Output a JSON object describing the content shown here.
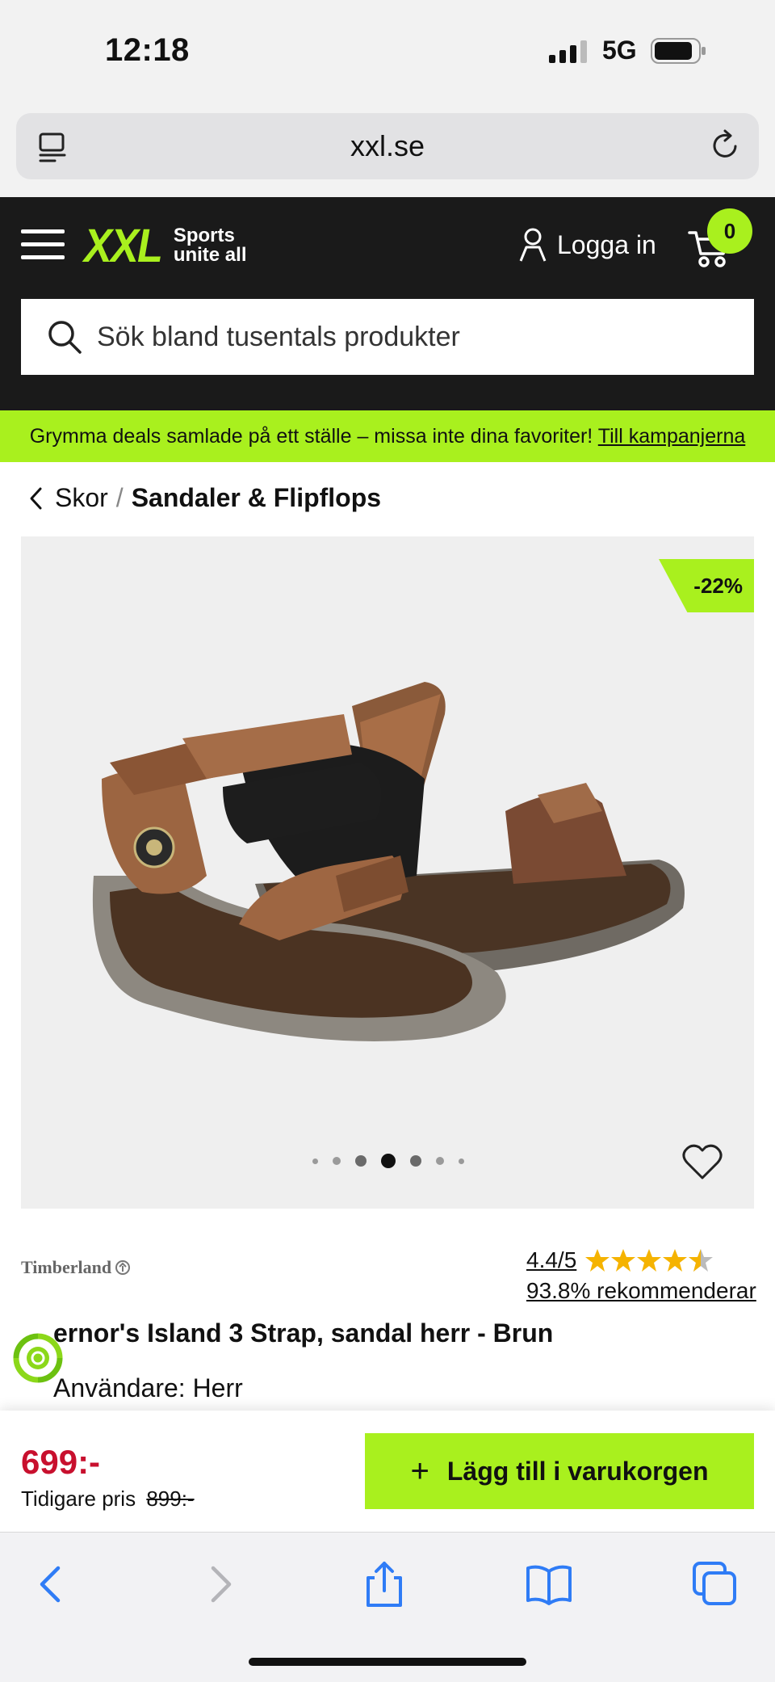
{
  "status_bar": {
    "time": "12:18",
    "network": "5G"
  },
  "browser": {
    "url": "xxl.se"
  },
  "header": {
    "logo_text": "XXL",
    "tagline_line1": "Sports",
    "tagline_line2": "unite all",
    "login_label": "Logga in",
    "cart_count": "0",
    "search_placeholder": "Sök bland tusentals produkter"
  },
  "promo": {
    "text": "Grymma deals samlade på ett ställe – missa inte dina favoriter! ",
    "link": "Till kampanjerna"
  },
  "breadcrumb": {
    "parent": "Skor",
    "separator": "/",
    "current": "Sandaler & Flipflops"
  },
  "product": {
    "discount_badge": "-22%",
    "image_carousel": {
      "total": 7,
      "active_index": 3
    },
    "brand": "Timberland",
    "rating": "4.4/5",
    "rating_score": 4.4,
    "recommend": "93.8% rekommenderar",
    "title": "ernor's Island 3 Strap, sandal herr - Brun",
    "users": "Användare: Herr"
  },
  "purchase": {
    "price": "699:-",
    "previous_label": "Tidigare pris",
    "previous_price": "899:-",
    "add_to_cart": "Lägg till i varukorgen"
  },
  "colors": {
    "accent": "#a9f01e",
    "header_bg": "#1a1a1a",
    "price": "#c8102e",
    "ios_blue": "#2f7cf6"
  }
}
